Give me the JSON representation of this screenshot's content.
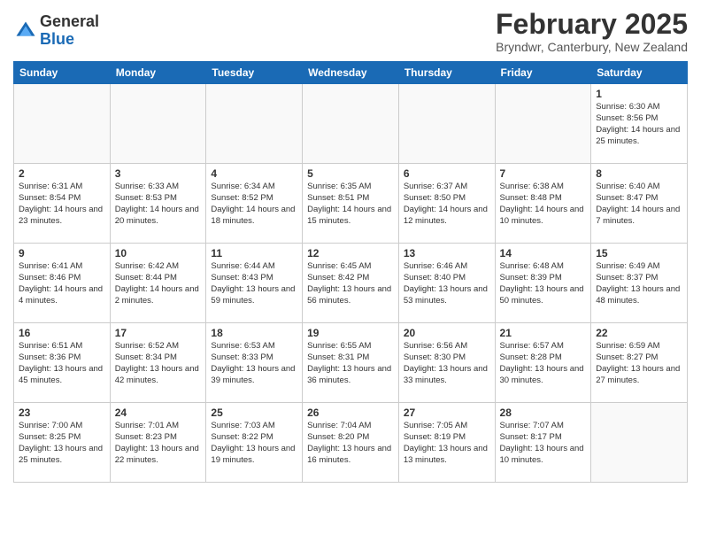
{
  "header": {
    "logo_general": "General",
    "logo_blue": "Blue",
    "month_title": "February 2025",
    "location": "Bryndwr, Canterbury, New Zealand"
  },
  "weekdays": [
    "Sunday",
    "Monday",
    "Tuesday",
    "Wednesday",
    "Thursday",
    "Friday",
    "Saturday"
  ],
  "weeks": [
    [
      null,
      null,
      null,
      null,
      null,
      null,
      {
        "day": "1",
        "info": "Sunrise: 6:30 AM\nSunset: 8:56 PM\nDaylight: 14 hours and 25 minutes."
      }
    ],
    [
      {
        "day": "2",
        "info": "Sunrise: 6:31 AM\nSunset: 8:54 PM\nDaylight: 14 hours and 23 minutes."
      },
      {
        "day": "3",
        "info": "Sunrise: 6:33 AM\nSunset: 8:53 PM\nDaylight: 14 hours and 20 minutes."
      },
      {
        "day": "4",
        "info": "Sunrise: 6:34 AM\nSunset: 8:52 PM\nDaylight: 14 hours and 18 minutes."
      },
      {
        "day": "5",
        "info": "Sunrise: 6:35 AM\nSunset: 8:51 PM\nDaylight: 14 hours and 15 minutes."
      },
      {
        "day": "6",
        "info": "Sunrise: 6:37 AM\nSunset: 8:50 PM\nDaylight: 14 hours and 12 minutes."
      },
      {
        "day": "7",
        "info": "Sunrise: 6:38 AM\nSunset: 8:48 PM\nDaylight: 14 hours and 10 minutes."
      },
      {
        "day": "8",
        "info": "Sunrise: 6:40 AM\nSunset: 8:47 PM\nDaylight: 14 hours and 7 minutes."
      }
    ],
    [
      {
        "day": "9",
        "info": "Sunrise: 6:41 AM\nSunset: 8:46 PM\nDaylight: 14 hours and 4 minutes."
      },
      {
        "day": "10",
        "info": "Sunrise: 6:42 AM\nSunset: 8:44 PM\nDaylight: 14 hours and 2 minutes."
      },
      {
        "day": "11",
        "info": "Sunrise: 6:44 AM\nSunset: 8:43 PM\nDaylight: 13 hours and 59 minutes."
      },
      {
        "day": "12",
        "info": "Sunrise: 6:45 AM\nSunset: 8:42 PM\nDaylight: 13 hours and 56 minutes."
      },
      {
        "day": "13",
        "info": "Sunrise: 6:46 AM\nSunset: 8:40 PM\nDaylight: 13 hours and 53 minutes."
      },
      {
        "day": "14",
        "info": "Sunrise: 6:48 AM\nSunset: 8:39 PM\nDaylight: 13 hours and 50 minutes."
      },
      {
        "day": "15",
        "info": "Sunrise: 6:49 AM\nSunset: 8:37 PM\nDaylight: 13 hours and 48 minutes."
      }
    ],
    [
      {
        "day": "16",
        "info": "Sunrise: 6:51 AM\nSunset: 8:36 PM\nDaylight: 13 hours and 45 minutes."
      },
      {
        "day": "17",
        "info": "Sunrise: 6:52 AM\nSunset: 8:34 PM\nDaylight: 13 hours and 42 minutes."
      },
      {
        "day": "18",
        "info": "Sunrise: 6:53 AM\nSunset: 8:33 PM\nDaylight: 13 hours and 39 minutes."
      },
      {
        "day": "19",
        "info": "Sunrise: 6:55 AM\nSunset: 8:31 PM\nDaylight: 13 hours and 36 minutes."
      },
      {
        "day": "20",
        "info": "Sunrise: 6:56 AM\nSunset: 8:30 PM\nDaylight: 13 hours and 33 minutes."
      },
      {
        "day": "21",
        "info": "Sunrise: 6:57 AM\nSunset: 8:28 PM\nDaylight: 13 hours and 30 minutes."
      },
      {
        "day": "22",
        "info": "Sunrise: 6:59 AM\nSunset: 8:27 PM\nDaylight: 13 hours and 27 minutes."
      }
    ],
    [
      {
        "day": "23",
        "info": "Sunrise: 7:00 AM\nSunset: 8:25 PM\nDaylight: 13 hours and 25 minutes."
      },
      {
        "day": "24",
        "info": "Sunrise: 7:01 AM\nSunset: 8:23 PM\nDaylight: 13 hours and 22 minutes."
      },
      {
        "day": "25",
        "info": "Sunrise: 7:03 AM\nSunset: 8:22 PM\nDaylight: 13 hours and 19 minutes."
      },
      {
        "day": "26",
        "info": "Sunrise: 7:04 AM\nSunset: 8:20 PM\nDaylight: 13 hours and 16 minutes."
      },
      {
        "day": "27",
        "info": "Sunrise: 7:05 AM\nSunset: 8:19 PM\nDaylight: 13 hours and 13 minutes."
      },
      {
        "day": "28",
        "info": "Sunrise: 7:07 AM\nSunset: 8:17 PM\nDaylight: 13 hours and 10 minutes."
      },
      null
    ]
  ]
}
